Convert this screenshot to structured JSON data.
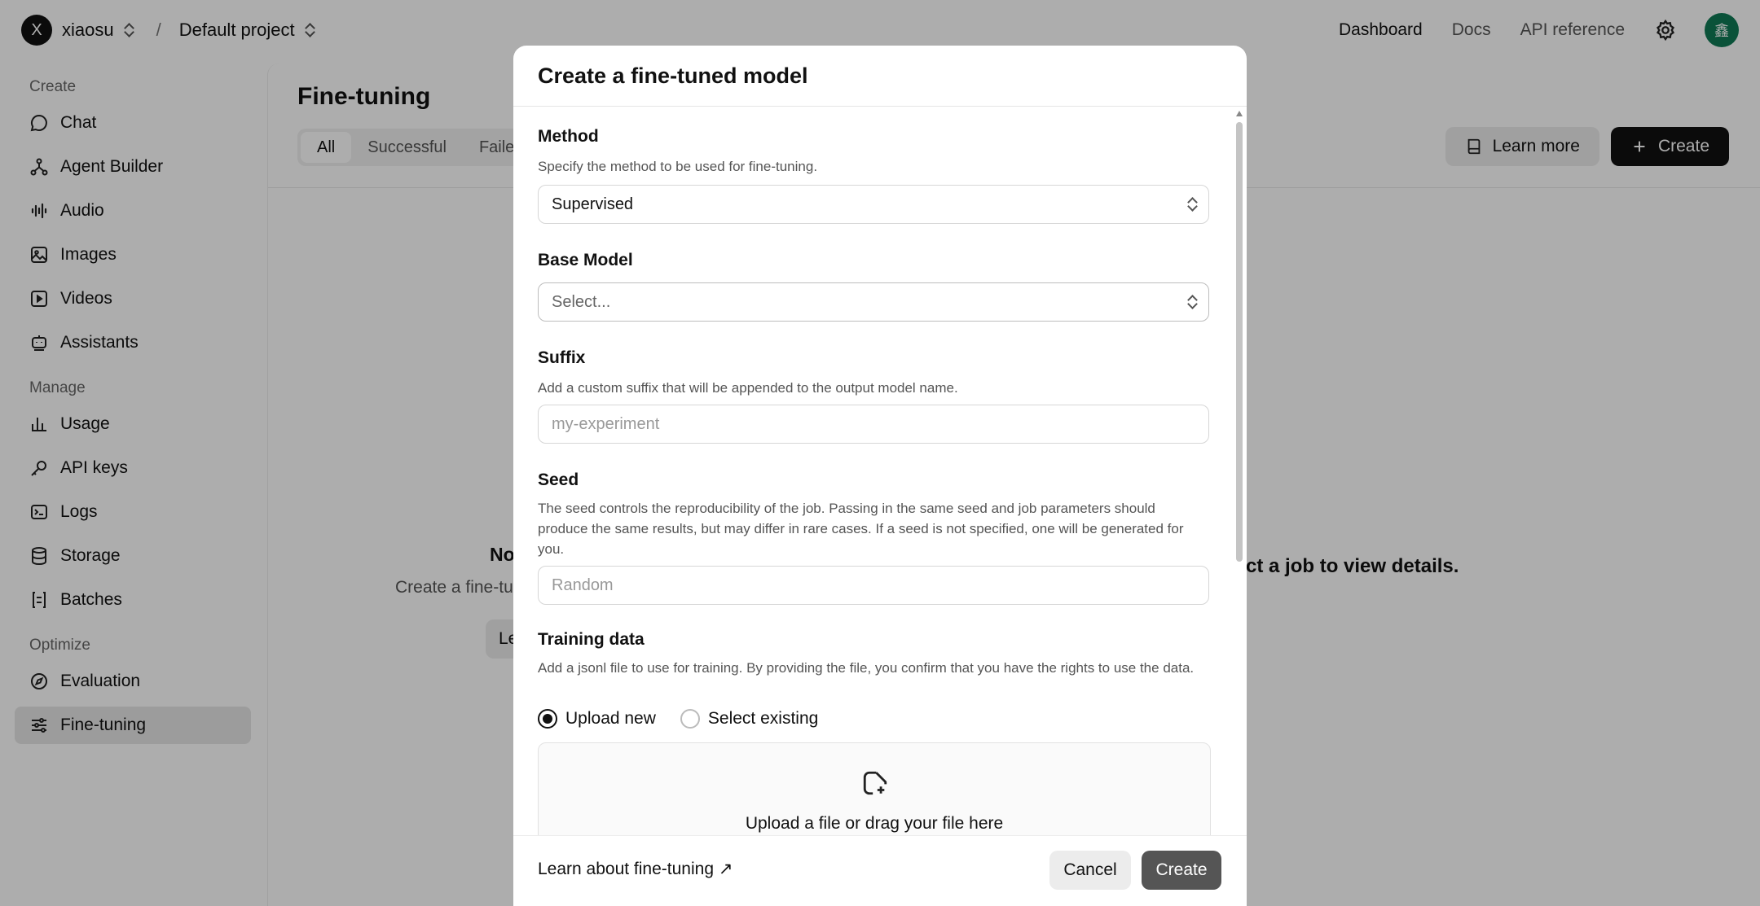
{
  "topbar": {
    "org_initial": "X",
    "org_name": "xiaosu",
    "separator": "/",
    "project_name": "Default project",
    "nav": [
      "Dashboard",
      "Docs",
      "API reference"
    ],
    "user_initial": "鑫"
  },
  "sidebar": {
    "sections": [
      {
        "title": "Create",
        "items": [
          {
            "label": "Chat",
            "icon": "chat-icon"
          },
          {
            "label": "Agent Builder",
            "icon": "agent-builder-icon"
          },
          {
            "label": "Audio",
            "icon": "audio-icon"
          },
          {
            "label": "Images",
            "icon": "images-icon"
          },
          {
            "label": "Videos",
            "icon": "videos-icon"
          },
          {
            "label": "Assistants",
            "icon": "assistants-icon"
          }
        ]
      },
      {
        "title": "Manage",
        "items": [
          {
            "label": "Usage",
            "icon": "usage-icon"
          },
          {
            "label": "API keys",
            "icon": "api-keys-icon"
          },
          {
            "label": "Logs",
            "icon": "logs-icon"
          },
          {
            "label": "Storage",
            "icon": "storage-icon"
          },
          {
            "label": "Batches",
            "icon": "batches-icon"
          }
        ]
      },
      {
        "title": "Optimize",
        "items": [
          {
            "label": "Evaluation",
            "icon": "evaluation-icon"
          },
          {
            "label": "Fine-tuning",
            "icon": "fine-tuning-icon",
            "active": true
          }
        ]
      }
    ]
  },
  "main": {
    "title": "Fine-tuning",
    "tabs": [
      "All",
      "Successful",
      "Failed"
    ],
    "learn_more": "Learn more",
    "create": "Create",
    "empty_title": "No",
    "empty_sub": "Create a fine-tu",
    "empty_btn": "Le",
    "right_hint": "lect a job to view details."
  },
  "modal": {
    "title": "Create a fine-tuned model",
    "method": {
      "label": "Method",
      "help": "Specify the method to be used for fine-tuning.",
      "value": "Supervised"
    },
    "base_model": {
      "label": "Base Model",
      "placeholder": "Select..."
    },
    "suffix": {
      "label": "Suffix",
      "help": "Add a custom suffix that will be appended to the output model name.",
      "placeholder": "my-experiment"
    },
    "seed": {
      "label": "Seed",
      "help": "The seed controls the reproducibility of the job. Passing in the same seed and job parameters should produce the same results, but may differ in rare cases. If a seed is not specified, one will be generated for you.",
      "placeholder": "Random"
    },
    "training": {
      "label": "Training data",
      "help": "Add a jsonl file to use for training. By providing the file, you confirm that you have the rights to use the data.",
      "upload_new": "Upload new",
      "select_existing": "Select existing",
      "dropzone": "Upload a file or drag your file here"
    },
    "footer": {
      "learn_link": "Learn about fine-tuning ↗",
      "cancel": "Cancel",
      "create": "Create"
    }
  }
}
